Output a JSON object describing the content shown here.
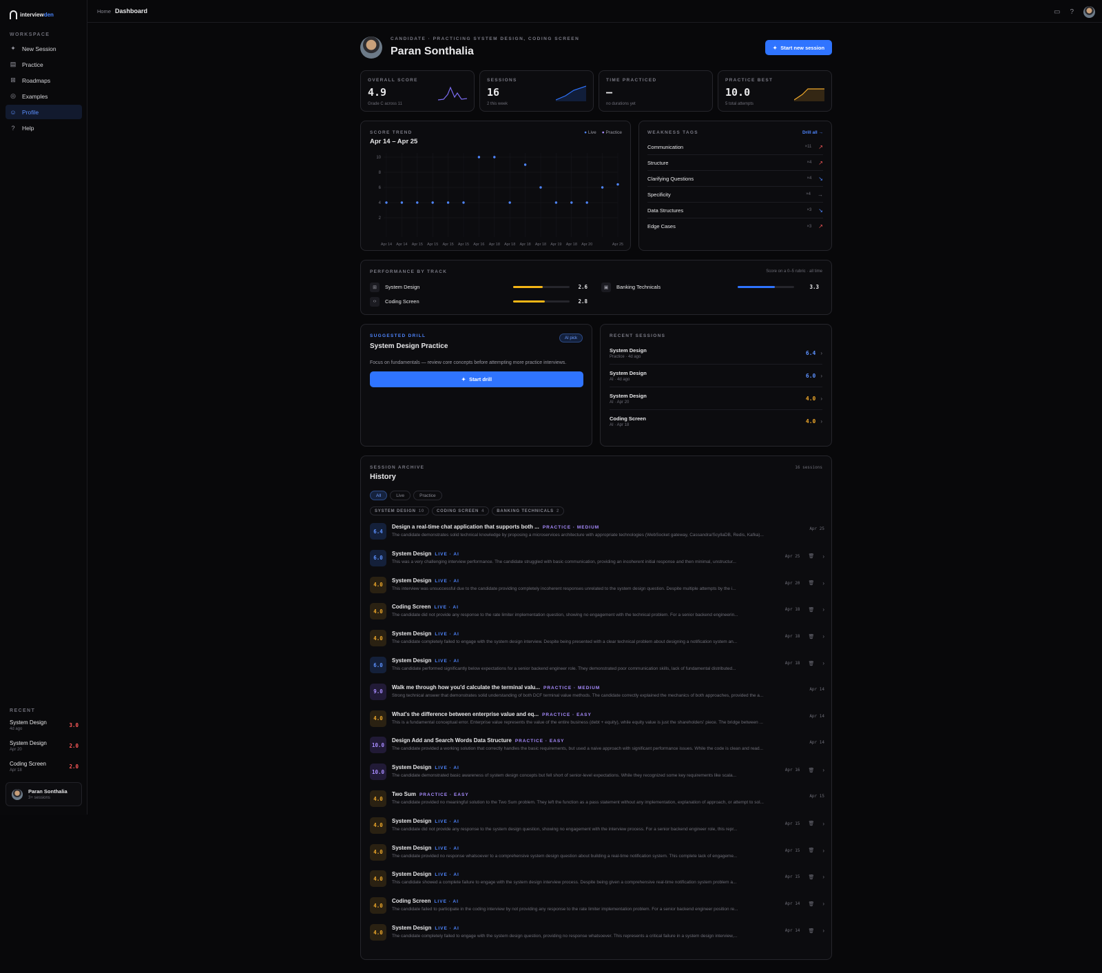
{
  "app": {
    "logo_a": "interview",
    "logo_b": "den"
  },
  "sidebar": {
    "workspace_label": "WORKSPACE",
    "items": [
      {
        "label": "New Session",
        "icon": "sparkle-icon"
      },
      {
        "label": "Practice",
        "icon": "book-icon"
      },
      {
        "label": "Roadmaps",
        "icon": "map-icon"
      },
      {
        "label": "Examples",
        "icon": "compass-icon"
      },
      {
        "label": "Profile",
        "icon": "user-icon"
      },
      {
        "label": "Help",
        "icon": "help-icon"
      }
    ],
    "recent_label": "RECENT",
    "recent": [
      {
        "title": "System Design",
        "sub": "4d ago",
        "score": "3.0"
      },
      {
        "title": "System Design",
        "sub": "Apr 20",
        "score": "2.0"
      },
      {
        "title": "Coding Screen",
        "sub": "Apr 18",
        "score": "2.0"
      }
    ],
    "user": {
      "name": "Paran Sonthalia",
      "sub": "3+ sessions"
    }
  },
  "topbar": {
    "home": "Home",
    "current": "Dashboard"
  },
  "profile": {
    "subtitle": "CANDIDATE · PRACTICING SYSTEM DESIGN, CODING SCREEN",
    "name": "Paran Sonthalia",
    "start_button": "Start new session"
  },
  "stats": [
    {
      "label": "OVERALL SCORE",
      "value": "4.9",
      "sub": "Grade C across 11"
    },
    {
      "label": "SESSIONS",
      "value": "16",
      "sub": "2 this week"
    },
    {
      "label": "TIME PRACTICED",
      "value": "—",
      "sub": "no durations yet"
    },
    {
      "label": "PRACTICE BEST",
      "value": "10.0",
      "sub": "5 total attempts"
    }
  ],
  "colors": {
    "accent": "#2f74ff",
    "live": "#4f86ff",
    "practice": "#a88cff",
    "amber": "#f0a92a",
    "red": "#ff5a5a"
  },
  "chart_data": {
    "type": "scatter",
    "label": "SCORE TREND",
    "title": "Apr 14 – Apr 25",
    "legend": [
      {
        "name": "Live"
      },
      {
        "name": "Practice"
      }
    ],
    "legend_position": "top-right",
    "ylim": [
      0,
      10
    ],
    "yticks": [
      2,
      4,
      6,
      8,
      10
    ],
    "grid": true,
    "categories": [
      "Apr 14",
      "Apr 14",
      "Apr 15",
      "Apr 15",
      "Apr 15",
      "Apr 15",
      "Apr 16",
      "Apr 18",
      "Apr 18",
      "Apr 18",
      "Apr 18",
      "Apr 19",
      "Apr 18",
      "Apr 20",
      "",
      "Apr 25"
    ],
    "values": [
      4,
      4,
      4,
      4,
      4,
      4,
      10,
      10,
      4,
      9,
      6,
      4,
      4,
      4,
      6,
      6.4
    ]
  },
  "weakness": {
    "label": "WEAKNESS TAGS",
    "drill_all": "Drill all →",
    "items": [
      {
        "name": "Communication",
        "count": "×11",
        "trend": "↗"
      },
      {
        "name": "Structure",
        "count": "×4",
        "trend": "↗"
      },
      {
        "name": "Clarifying Questions",
        "count": "×4",
        "trend": "↘"
      },
      {
        "name": "Specificity",
        "count": "×4",
        "trend": "→"
      },
      {
        "name": "Data Structures",
        "count": "×3",
        "trend": "↘"
      },
      {
        "name": "Edge Cases",
        "count": "×3",
        "trend": "↗"
      }
    ]
  },
  "performance": {
    "label": "PERFORMANCE BY TRACK",
    "note": "Score on a 0–5 rubric · all time",
    "tracks": [
      {
        "name": "System Design",
        "score": "2.6",
        "value": 2.6,
        "color": "#f5b616"
      },
      {
        "name": "Coding Screen",
        "score": "2.8",
        "value": 2.8,
        "color": "#f5b616"
      },
      {
        "name": "Banking Technicals",
        "score": "3.3",
        "value": 3.3,
        "color": "#2f74ff"
      }
    ]
  },
  "drill": {
    "label": "SUGGESTED DRILL",
    "badge": "AI pick",
    "title": "System Design Practice",
    "desc": "Focus on fundamentals — review core concepts before attempting more practice interviews.",
    "button": "Start drill"
  },
  "recent_sessions": {
    "label": "RECENT SESSIONS",
    "items": [
      {
        "title": "System Design",
        "sub": "Practice · 4d ago",
        "score": "6.4",
        "color": "blue"
      },
      {
        "title": "System Design",
        "sub": "AI · 4d ago",
        "score": "6.0",
        "color": "blue"
      },
      {
        "title": "System Design",
        "sub": "AI · Apr 20",
        "score": "4.0",
        "color": "amber"
      },
      {
        "title": "Coding Screen",
        "sub": "AI · Apr 18",
        "score": "4.0",
        "color": "amber"
      }
    ]
  },
  "history": {
    "label": "SESSION ARCHIVE",
    "title": "History",
    "count": "16 sessions",
    "filters": [
      "All",
      "Live",
      "Practice"
    ],
    "tracks": [
      {
        "name": "SYSTEM DESIGN",
        "n": "10"
      },
      {
        "name": "CODING SCREEN",
        "n": "4"
      },
      {
        "name": "BANKING TECHNICALS",
        "n": "2"
      }
    ],
    "rows": [
      {
        "score": "6.4",
        "c": "blue",
        "title": "Design a real-time chat application that supports both ...",
        "tag": "PRACTICE · MEDIUM",
        "kind": "prac",
        "desc": "The candidate demonstrates solid technical knowledge by proposing a microservices architecture with appropriate technologies (WebSocket gateway, Cassandra/ScyllaDB, Redis, Kafka)...",
        "date": "Apr 25",
        "actions": false
      },
      {
        "score": "6.0",
        "c": "blue",
        "title": "System Design",
        "tag": "LIVE · AI",
        "kind": "live",
        "desc": "This was a very challenging interview performance. The candidate struggled with basic communication, providing an incoherent initial response and then minimal, unstructur...",
        "date": "Apr 25",
        "actions": true
      },
      {
        "score": "4.0",
        "c": "amber",
        "title": "System Design",
        "tag": "LIVE · AI",
        "kind": "live",
        "desc": "This interview was unsuccessful due to the candidate providing completely incoherent responses unrelated to the system design question. Despite multiple attempts by the i...",
        "date": "Apr 20",
        "actions": true
      },
      {
        "score": "4.0",
        "c": "amber",
        "title": "Coding Screen",
        "tag": "LIVE · AI",
        "kind": "live",
        "desc": "The candidate did not provide any response to the rate limiter implementation question, showing no engagement with the technical problem. For a senior backend engineerin...",
        "date": "Apr 18",
        "actions": true
      },
      {
        "score": "4.0",
        "c": "amber",
        "title": "System Design",
        "tag": "LIVE · AI",
        "kind": "live",
        "desc": "The candidate completely failed to engage with the system design interview. Despite being presented with a clear technical problem about designing a notification system an...",
        "date": "Apr 18",
        "actions": true
      },
      {
        "score": "6.0",
        "c": "blue",
        "title": "System Design",
        "tag": "LIVE · AI",
        "kind": "live",
        "desc": "This candidate performed significantly below expectations for a senior backend engineer role. They demonstrated poor communication skills, lack of fundamental distributed...",
        "date": "Apr 18",
        "actions": true
      },
      {
        "score": "9.0",
        "c": "purple",
        "title": "Walk me through how you'd calculate the terminal valu...",
        "tag": "PRACTICE · MEDIUM",
        "kind": "prac",
        "desc": "Strong technical answer that demonstrates solid understanding of both DCF terminal value methods. The candidate correctly explained the mechanics of both approaches, provided the a...",
        "date": "Apr 14",
        "actions": false
      },
      {
        "score": "4.0",
        "c": "amber",
        "title": "What's the difference between enterprise value and eq...",
        "tag": "PRACTICE · EASY",
        "kind": "prac",
        "desc": "This is a fundamental conceptual error. Enterprise value represents the value of the entire business (debt + equity), while equity value is just the shareholders' piece. The bridge between ...",
        "date": "Apr 14",
        "actions": false
      },
      {
        "score": "10.0",
        "c": "purple",
        "title": "Design Add and Search Words Data Structure",
        "tag": "PRACTICE · EASY",
        "kind": "prac",
        "desc": "The candidate provided a working solution that correctly handles the basic requirements, but used a naive approach with significant performance issues. While the code is clean and read...",
        "date": "Apr 14",
        "actions": false
      },
      {
        "score": "10.0",
        "c": "purple",
        "title": "System Design",
        "tag": "LIVE · AI",
        "kind": "live",
        "desc": "The candidate demonstrated basic awareness of system design concepts but fell short of senior-level expectations. While they recognized some key requirements like scala...",
        "date": "Apr 16",
        "actions": true
      },
      {
        "score": "4.0",
        "c": "amber",
        "title": "Two Sum",
        "tag": "PRACTICE · EASY",
        "kind": "prac",
        "desc": "The candidate provided no meaningful solution to the Two Sum problem. They left the function as a pass statement without any implementation, explanation of approach, or attempt to sol...",
        "date": "Apr 15",
        "actions": false
      },
      {
        "score": "4.0",
        "c": "amber",
        "title": "System Design",
        "tag": "LIVE · AI",
        "kind": "live",
        "desc": "The candidate did not provide any response to the system design question, showing no engagement with the interview process. For a senior backend engineer role, this repr...",
        "date": "Apr 15",
        "actions": true
      },
      {
        "score": "4.0",
        "c": "amber",
        "title": "System Design",
        "tag": "LIVE · AI",
        "kind": "live",
        "desc": "The candidate provided no response whatsoever to a comprehensive system design question about building a real-time notification system. This complete lack of engageme...",
        "date": "Apr 15",
        "actions": true
      },
      {
        "score": "4.0",
        "c": "amber",
        "title": "System Design",
        "tag": "LIVE · AI",
        "kind": "live",
        "desc": "This candidate showed a complete failure to engage with the system design interview process. Despite being given a comprehensive real-time notification system problem a...",
        "date": "Apr 15",
        "actions": true
      },
      {
        "score": "4.0",
        "c": "amber",
        "title": "Coding Screen",
        "tag": "LIVE · AI",
        "kind": "live",
        "desc": "The candidate failed to participate in the coding interview by not providing any response to the rate limiter implementation problem. For a senior backend engineer position re...",
        "date": "Apr 14",
        "actions": true
      },
      {
        "score": "4.0",
        "c": "amber",
        "title": "System Design",
        "tag": "LIVE · AI",
        "kind": "live",
        "desc": "The candidate completely failed to engage with the system design question, providing no response whatsoever. This represents a critical failure in a system design interview,...",
        "date": "Apr 14",
        "actions": true
      }
    ]
  }
}
